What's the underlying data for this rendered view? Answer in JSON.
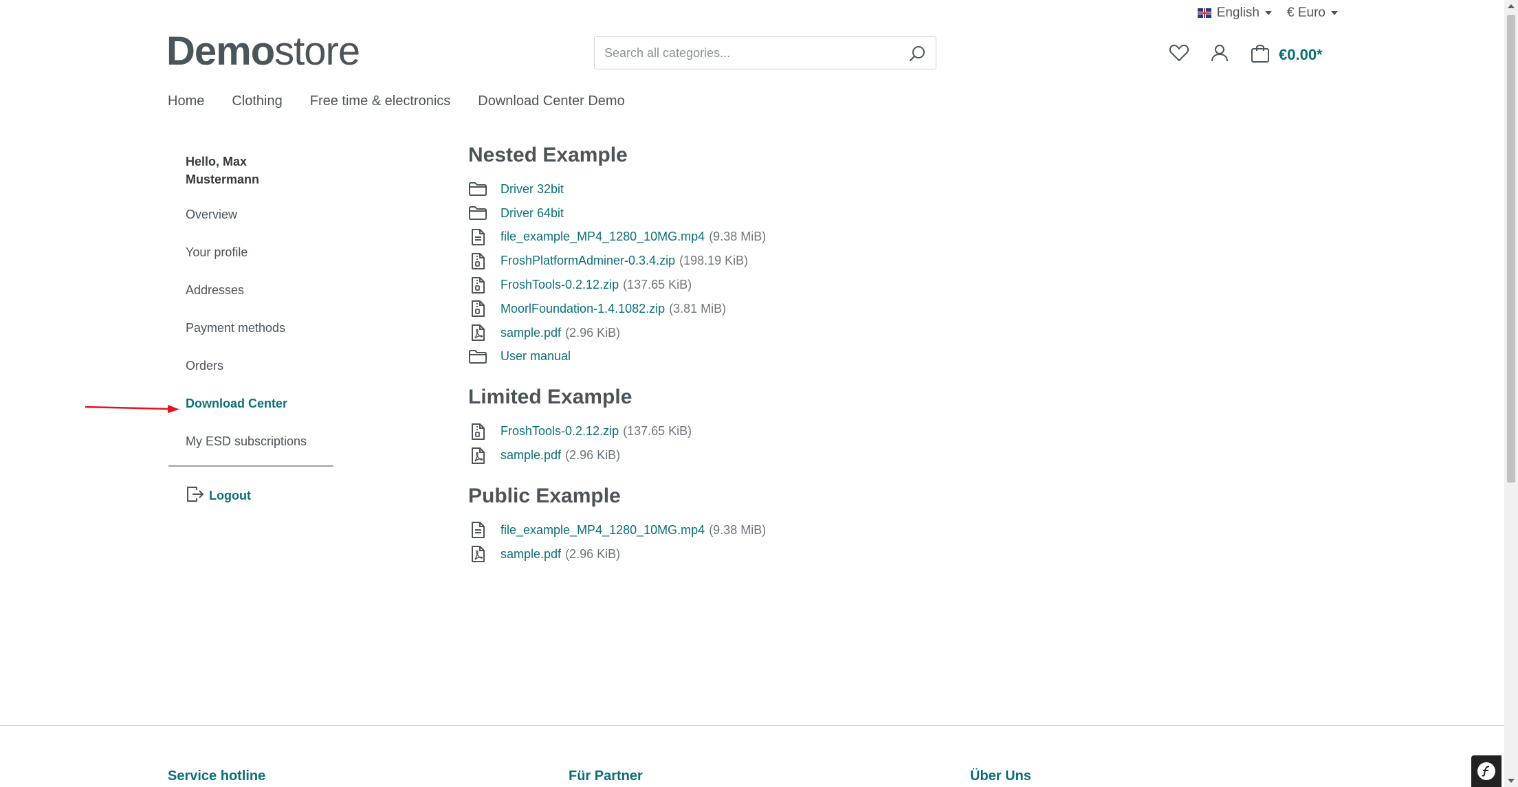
{
  "topbar": {
    "language": "English",
    "currency": "€ Euro"
  },
  "header": {
    "logo_bold": "Demo",
    "logo_light": "store",
    "search_placeholder": "Search all categories...",
    "cart_total": "€0.00*"
  },
  "nav": {
    "items": [
      "Home",
      "Clothing",
      "Free time & electronics",
      "Download Center Demo"
    ]
  },
  "sidebar": {
    "greeting": "Hello, Max Mustermann",
    "items": [
      "Overview",
      "Your profile",
      "Addresses",
      "Payment methods",
      "Orders",
      "Download Center",
      "My ESD subscriptions"
    ],
    "logout": "Logout"
  },
  "sections": [
    {
      "title": "Nested Example",
      "files": [
        {
          "name": "Driver 32bit",
          "size": "",
          "icon": "folder-icon"
        },
        {
          "name": "Driver 64bit",
          "size": "",
          "icon": "folder-icon"
        },
        {
          "name": "file_example_MP4_1280_10MG.mp4",
          "size": "(9.38 MiB)",
          "icon": "file-text-icon"
        },
        {
          "name": "FroshPlatformAdminer-0.3.4.zip",
          "size": "(198.19 KiB)",
          "icon": "file-zip-icon"
        },
        {
          "name": "FroshTools-0.2.12.zip",
          "size": "(137.65 KiB)",
          "icon": "file-zip-icon"
        },
        {
          "name": "MoorlFoundation-1.4.1082.zip",
          "size": "(3.81 MiB)",
          "icon": "file-zip-icon"
        },
        {
          "name": "sample.pdf",
          "size": "(2.96 KiB)",
          "icon": "file-pdf-icon"
        },
        {
          "name": "User manual",
          "size": "",
          "icon": "folder-icon"
        }
      ]
    },
    {
      "title": "Limited Example",
      "files": [
        {
          "name": "FroshTools-0.2.12.zip",
          "size": "(137.65 KiB)",
          "icon": "file-zip-icon"
        },
        {
          "name": "sample.pdf",
          "size": "(2.96 KiB)",
          "icon": "file-pdf-icon"
        }
      ]
    },
    {
      "title": "Public Example",
      "files": [
        {
          "name": "file_example_MP4_1280_10MG.mp4",
          "size": "(9.38 MiB)",
          "icon": "file-text-icon"
        },
        {
          "name": "sample.pdf",
          "size": "(2.96 KiB)",
          "icon": "file-pdf-icon"
        }
      ]
    }
  ],
  "footer": {
    "columns": [
      "Service hotline",
      "Für Partner",
      "Über Uns"
    ]
  },
  "colors": {
    "accent": "#0b6f77",
    "text": "#4a545b",
    "annotation_arrow": "#e3141b"
  }
}
